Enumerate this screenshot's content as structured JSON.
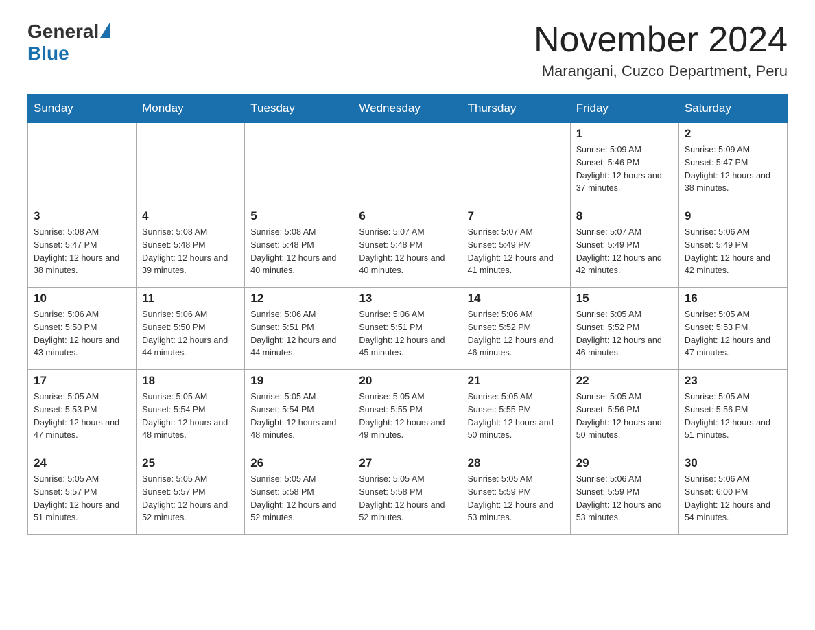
{
  "header": {
    "logo_general": "General",
    "logo_blue": "Blue",
    "month_title": "November 2024",
    "location": "Marangani, Cuzco Department, Peru"
  },
  "days_of_week": [
    "Sunday",
    "Monday",
    "Tuesday",
    "Wednesday",
    "Thursday",
    "Friday",
    "Saturday"
  ],
  "weeks": [
    [
      {
        "day": "",
        "sunrise": "",
        "sunset": "",
        "daylight": ""
      },
      {
        "day": "",
        "sunrise": "",
        "sunset": "",
        "daylight": ""
      },
      {
        "day": "",
        "sunrise": "",
        "sunset": "",
        "daylight": ""
      },
      {
        "day": "",
        "sunrise": "",
        "sunset": "",
        "daylight": ""
      },
      {
        "day": "",
        "sunrise": "",
        "sunset": "",
        "daylight": ""
      },
      {
        "day": "1",
        "sunrise": "Sunrise: 5:09 AM",
        "sunset": "Sunset: 5:46 PM",
        "daylight": "Daylight: 12 hours and 37 minutes."
      },
      {
        "day": "2",
        "sunrise": "Sunrise: 5:09 AM",
        "sunset": "Sunset: 5:47 PM",
        "daylight": "Daylight: 12 hours and 38 minutes."
      }
    ],
    [
      {
        "day": "3",
        "sunrise": "Sunrise: 5:08 AM",
        "sunset": "Sunset: 5:47 PM",
        "daylight": "Daylight: 12 hours and 38 minutes."
      },
      {
        "day": "4",
        "sunrise": "Sunrise: 5:08 AM",
        "sunset": "Sunset: 5:48 PM",
        "daylight": "Daylight: 12 hours and 39 minutes."
      },
      {
        "day": "5",
        "sunrise": "Sunrise: 5:08 AM",
        "sunset": "Sunset: 5:48 PM",
        "daylight": "Daylight: 12 hours and 40 minutes."
      },
      {
        "day": "6",
        "sunrise": "Sunrise: 5:07 AM",
        "sunset": "Sunset: 5:48 PM",
        "daylight": "Daylight: 12 hours and 40 minutes."
      },
      {
        "day": "7",
        "sunrise": "Sunrise: 5:07 AM",
        "sunset": "Sunset: 5:49 PM",
        "daylight": "Daylight: 12 hours and 41 minutes."
      },
      {
        "day": "8",
        "sunrise": "Sunrise: 5:07 AM",
        "sunset": "Sunset: 5:49 PM",
        "daylight": "Daylight: 12 hours and 42 minutes."
      },
      {
        "day": "9",
        "sunrise": "Sunrise: 5:06 AM",
        "sunset": "Sunset: 5:49 PM",
        "daylight": "Daylight: 12 hours and 42 minutes."
      }
    ],
    [
      {
        "day": "10",
        "sunrise": "Sunrise: 5:06 AM",
        "sunset": "Sunset: 5:50 PM",
        "daylight": "Daylight: 12 hours and 43 minutes."
      },
      {
        "day": "11",
        "sunrise": "Sunrise: 5:06 AM",
        "sunset": "Sunset: 5:50 PM",
        "daylight": "Daylight: 12 hours and 44 minutes."
      },
      {
        "day": "12",
        "sunrise": "Sunrise: 5:06 AM",
        "sunset": "Sunset: 5:51 PM",
        "daylight": "Daylight: 12 hours and 44 minutes."
      },
      {
        "day": "13",
        "sunrise": "Sunrise: 5:06 AM",
        "sunset": "Sunset: 5:51 PM",
        "daylight": "Daylight: 12 hours and 45 minutes."
      },
      {
        "day": "14",
        "sunrise": "Sunrise: 5:06 AM",
        "sunset": "Sunset: 5:52 PM",
        "daylight": "Daylight: 12 hours and 46 minutes."
      },
      {
        "day": "15",
        "sunrise": "Sunrise: 5:05 AM",
        "sunset": "Sunset: 5:52 PM",
        "daylight": "Daylight: 12 hours and 46 minutes."
      },
      {
        "day": "16",
        "sunrise": "Sunrise: 5:05 AM",
        "sunset": "Sunset: 5:53 PM",
        "daylight": "Daylight: 12 hours and 47 minutes."
      }
    ],
    [
      {
        "day": "17",
        "sunrise": "Sunrise: 5:05 AM",
        "sunset": "Sunset: 5:53 PM",
        "daylight": "Daylight: 12 hours and 47 minutes."
      },
      {
        "day": "18",
        "sunrise": "Sunrise: 5:05 AM",
        "sunset": "Sunset: 5:54 PM",
        "daylight": "Daylight: 12 hours and 48 minutes."
      },
      {
        "day": "19",
        "sunrise": "Sunrise: 5:05 AM",
        "sunset": "Sunset: 5:54 PM",
        "daylight": "Daylight: 12 hours and 48 minutes."
      },
      {
        "day": "20",
        "sunrise": "Sunrise: 5:05 AM",
        "sunset": "Sunset: 5:55 PM",
        "daylight": "Daylight: 12 hours and 49 minutes."
      },
      {
        "day": "21",
        "sunrise": "Sunrise: 5:05 AM",
        "sunset": "Sunset: 5:55 PM",
        "daylight": "Daylight: 12 hours and 50 minutes."
      },
      {
        "day": "22",
        "sunrise": "Sunrise: 5:05 AM",
        "sunset": "Sunset: 5:56 PM",
        "daylight": "Daylight: 12 hours and 50 minutes."
      },
      {
        "day": "23",
        "sunrise": "Sunrise: 5:05 AM",
        "sunset": "Sunset: 5:56 PM",
        "daylight": "Daylight: 12 hours and 51 minutes."
      }
    ],
    [
      {
        "day": "24",
        "sunrise": "Sunrise: 5:05 AM",
        "sunset": "Sunset: 5:57 PM",
        "daylight": "Daylight: 12 hours and 51 minutes."
      },
      {
        "day": "25",
        "sunrise": "Sunrise: 5:05 AM",
        "sunset": "Sunset: 5:57 PM",
        "daylight": "Daylight: 12 hours and 52 minutes."
      },
      {
        "day": "26",
        "sunrise": "Sunrise: 5:05 AM",
        "sunset": "Sunset: 5:58 PM",
        "daylight": "Daylight: 12 hours and 52 minutes."
      },
      {
        "day": "27",
        "sunrise": "Sunrise: 5:05 AM",
        "sunset": "Sunset: 5:58 PM",
        "daylight": "Daylight: 12 hours and 52 minutes."
      },
      {
        "day": "28",
        "sunrise": "Sunrise: 5:05 AM",
        "sunset": "Sunset: 5:59 PM",
        "daylight": "Daylight: 12 hours and 53 minutes."
      },
      {
        "day": "29",
        "sunrise": "Sunrise: 5:06 AM",
        "sunset": "Sunset: 5:59 PM",
        "daylight": "Daylight: 12 hours and 53 minutes."
      },
      {
        "day": "30",
        "sunrise": "Sunrise: 5:06 AM",
        "sunset": "Sunset: 6:00 PM",
        "daylight": "Daylight: 12 hours and 54 minutes."
      }
    ]
  ]
}
